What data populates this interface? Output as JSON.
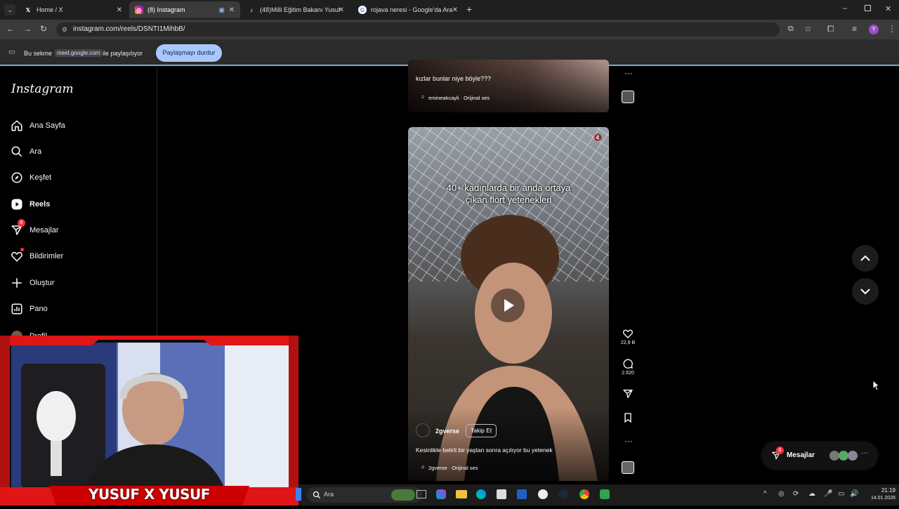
{
  "browser": {
    "tabs": [
      {
        "title": "Home / X",
        "favicon": "x-logo-icon"
      },
      {
        "title": "(8) Instagram",
        "favicon": "instagram-icon",
        "active": true
      },
      {
        "title": "(48)Milli Eğitim Bakanı Yusuf Te",
        "favicon": "tiktok-icon"
      },
      {
        "title": "rojava neresi - Google'da Ara",
        "favicon": "google-icon"
      }
    ],
    "url": "instagram.com/reels/DSNTI1MihbB/",
    "share_bar": {
      "prefix": "Bu sekme",
      "domain": "meet.google.com",
      "suffix": "ile paylaşılıyor",
      "stop_button": "Paylaşmayı durdur"
    }
  },
  "instagram": {
    "logo": "Instagram",
    "nav": [
      {
        "label": "Ana Sayfa",
        "icon": "home-icon"
      },
      {
        "label": "Ara",
        "icon": "search-icon"
      },
      {
        "label": "Keşfet",
        "icon": "compass-icon"
      },
      {
        "label": "Reels",
        "icon": "reels-icon",
        "active": true
      },
      {
        "label": "Mesajlar",
        "icon": "messenger-icon",
        "badge": "8"
      },
      {
        "label": "Bildirimler",
        "icon": "heart-icon"
      },
      {
        "label": "Oluştur",
        "icon": "plus-icon"
      },
      {
        "label": "Pano",
        "icon": "dashboard-icon"
      },
      {
        "label": "Profil",
        "icon": "avatar-icon"
      }
    ],
    "prev_reel": {
      "caption": "kızlar bunlar niye böyle???",
      "audio": "emineakcayli · Orijinal ses"
    },
    "current_reel": {
      "overlay_text_line1": "40+ kadınlarda bir anda ortaya",
      "overlay_text_line2": "çıkan flört yetenekleri",
      "username": "2gverse",
      "follow_button": "Takip Et",
      "caption": "Kesinlikle belirli bir yaştan sonra açılıyor bu yetenek",
      "audio": "2gverse · Orijinal ses",
      "likes": "22,9 B",
      "comments": "2.620"
    },
    "messages_pill": {
      "label": "Mesajlar",
      "badge": "8"
    }
  },
  "webcam": {
    "banner": "YUSUF X YUSUF"
  },
  "taskbar": {
    "search_placeholder": "Ara",
    "time": "21:19",
    "date": "14.01.2026"
  },
  "colors": {
    "accent": "#a9c7fa",
    "badge": "#ff3040",
    "webcam_frame": "#e01515"
  }
}
